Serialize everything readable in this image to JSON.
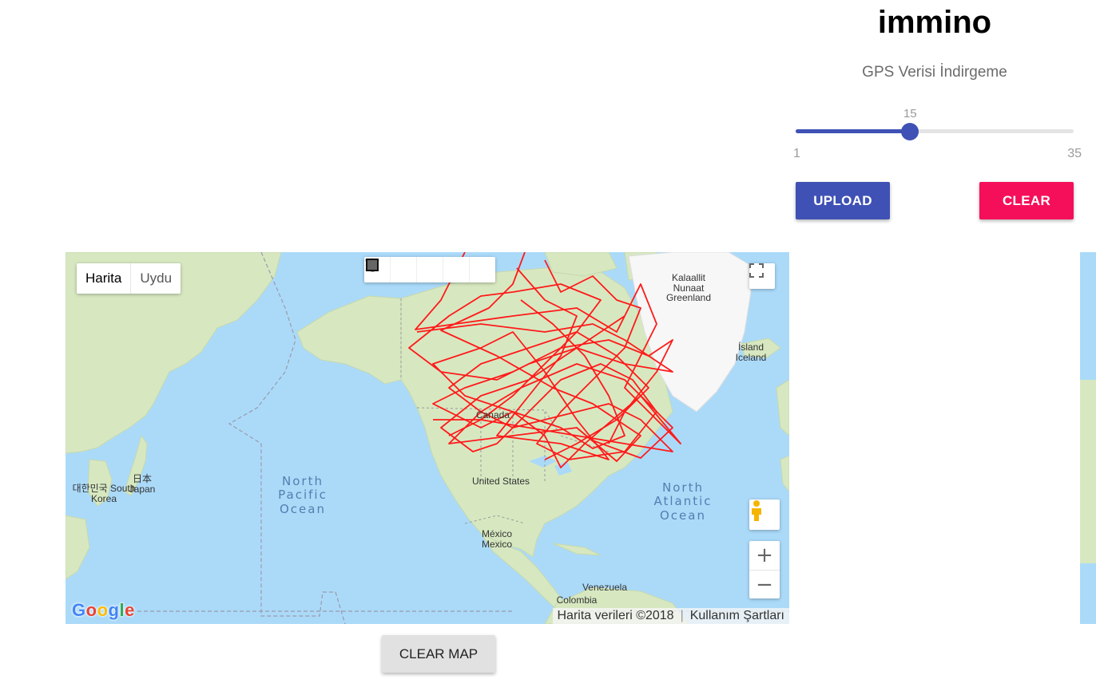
{
  "app": {
    "title": "immino",
    "subtitle": "GPS Verisi İndirgeme"
  },
  "slider": {
    "value": "15",
    "min": "1",
    "max": "35",
    "fraction": 0.4118
  },
  "buttons": {
    "upload": "UPLOAD",
    "clear": "CLEAR",
    "clear_map": "CLEAR MAP"
  },
  "map": {
    "type_active": "Harita",
    "type_other": "Uydu",
    "labels": {
      "greenland": "Kalaallit Nunaat Greenland",
      "iceland": "Ísland Iceland",
      "canada": "Canada",
      "usa": "United States",
      "mexico": "México Mexico",
      "venezuela": "Venezuela",
      "colombia": "Colombia",
      "japan": "日本 Japan",
      "korea": "대한민국 South Korea",
      "north_pacific": "North Pacific Ocean",
      "north_atlantic": "North Atlantic Ocean"
    },
    "google_logo": "Google",
    "attribution": "Harita verileri ©2018",
    "terms": "Kullanım Şartları",
    "zoom_in": "+",
    "zoom_out": "−",
    "draw_tools": [
      "hand-icon",
      "circle-icon",
      "polygon-icon",
      "polyline-icon",
      "rectangle-icon"
    ],
    "track_color": "#ff1a1a"
  },
  "colors": {
    "primary": "#3f51b5",
    "accent": "#f50f5a",
    "water": "#abdaf9",
    "land": "#d7e8c1"
  }
}
